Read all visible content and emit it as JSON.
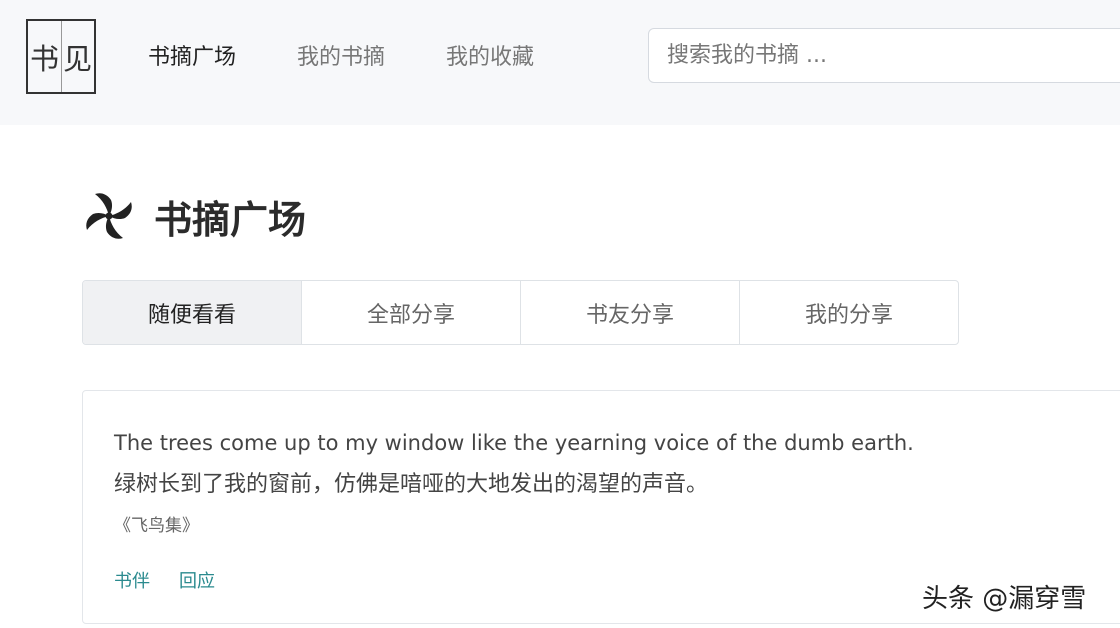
{
  "navbar": {
    "logo": {
      "char1": "书",
      "char2": "见"
    },
    "links": [
      {
        "label": "书摘广场",
        "active": true
      },
      {
        "label": "我的书摘",
        "active": false
      },
      {
        "label": "我的收藏",
        "active": false
      }
    ],
    "search_placeholder": "搜索我的书摘 ..."
  },
  "page": {
    "title": "书摘广场",
    "icon": "pinwheel-icon"
  },
  "tabs": [
    {
      "label": "随便看看",
      "active": true
    },
    {
      "label": "全部分享",
      "active": false
    },
    {
      "label": "书友分享",
      "active": false
    },
    {
      "label": "我的分享",
      "active": false
    }
  ],
  "card": {
    "quote_en": "The trees come up to my window like the yearning voice of the dumb earth.",
    "quote_zh": "绿树长到了我的窗前，仿佛是喑哑的大地发出的渴望的声音。",
    "source": "《飞鸟集》",
    "actions": [
      "书伴",
      "回应"
    ]
  },
  "watermark": "头条 @漏穿雪",
  "colors": {
    "accent": "#2a8a8e",
    "navbar_bg": "#f7f8fa",
    "active_tab_bg": "#f0f1f3"
  }
}
